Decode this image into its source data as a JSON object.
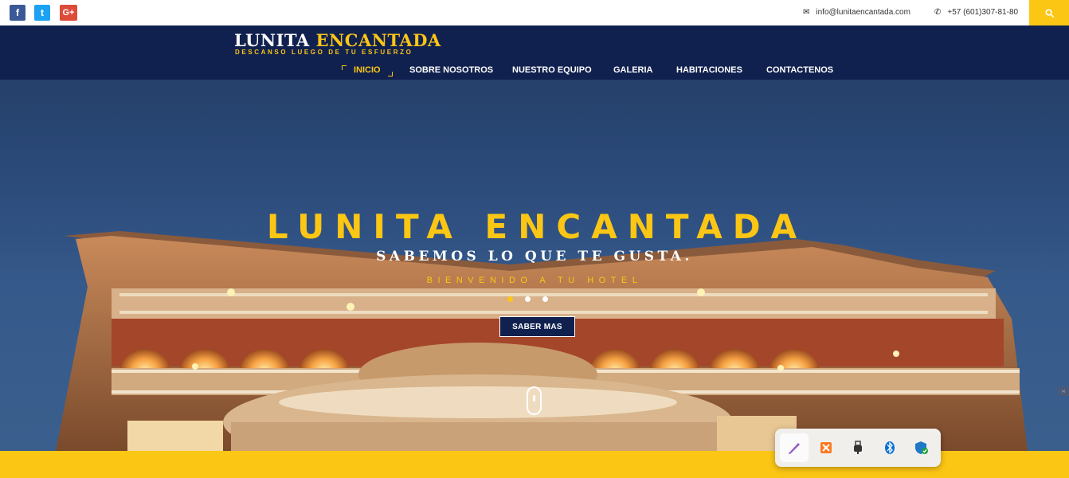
{
  "topbar": {
    "social": [
      {
        "name": "facebook",
        "glyph": "f"
      },
      {
        "name": "twitter",
        "glyph": "t"
      },
      {
        "name": "google-plus",
        "glyph": "G+"
      }
    ],
    "email": "info@lunitaencantada.com",
    "phone": "+57 (601)307-81-80",
    "accent_color": "#fcc615"
  },
  "header": {
    "logo_word1": "LUNITA",
    "logo_word2": "ENCANTADA",
    "tagline": "DESCANSO LUEGO DE TU ESFUERZO",
    "brand_navy": "#11214f"
  },
  "nav": {
    "items": [
      {
        "label": "INICIO",
        "active": true
      },
      {
        "label": "SOBRE NOSOTROS",
        "active": false
      },
      {
        "label": "NUESTRO EQUIPO",
        "active": false
      },
      {
        "label": "GALERIA",
        "active": false
      },
      {
        "label": "HABITACIONES",
        "active": false
      },
      {
        "label": "CONTACTENOS",
        "active": false
      }
    ]
  },
  "hero": {
    "title": "LUNITA ENCANTADA",
    "subtitle": "SABEMOS LO QUE TE GUSTA.",
    "welcome": "BIENVENIDO A TU HOTEL",
    "slides_total": 3,
    "active_slide": 1,
    "cta_label": "SABER MAS"
  },
  "tray": {
    "icons": [
      "pen-app-icon",
      "xampp-icon",
      "usb-device-icon",
      "bluetooth-icon",
      "security-shield-icon"
    ]
  }
}
